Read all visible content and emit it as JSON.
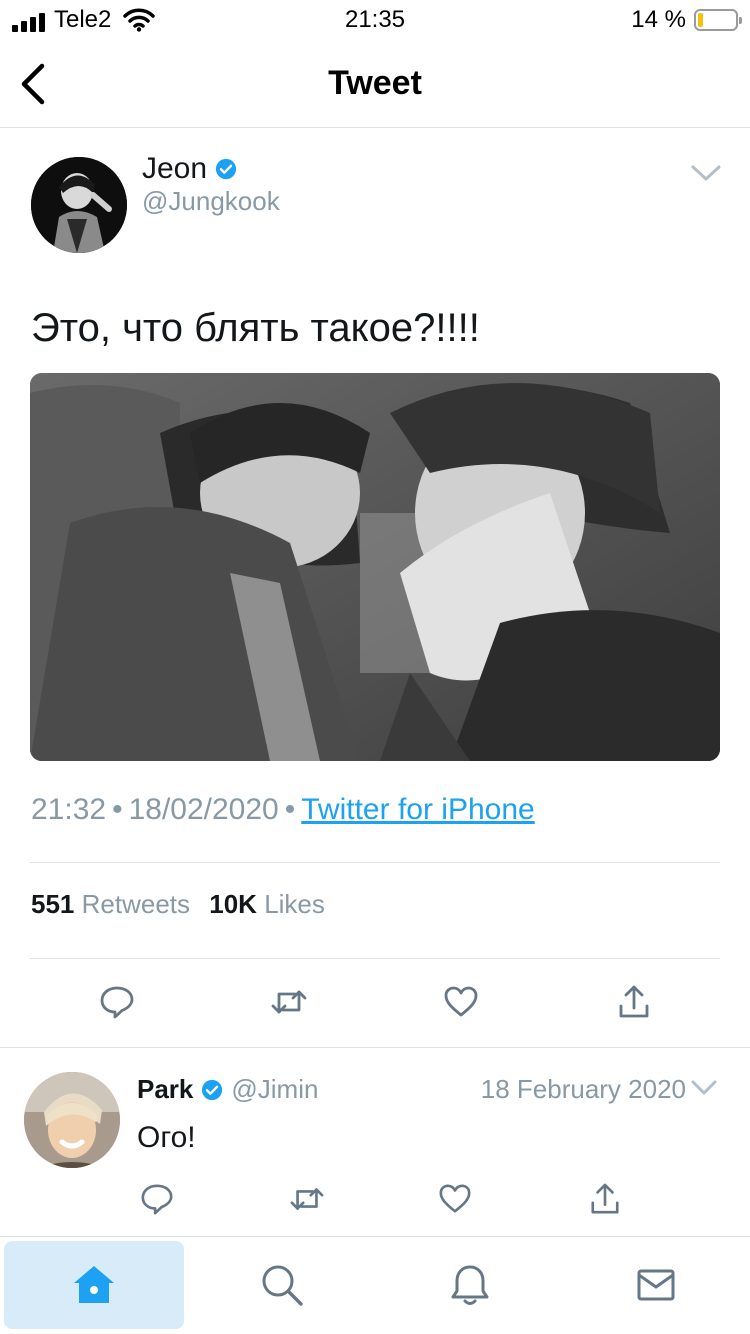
{
  "status_bar": {
    "carrier": "Tele2",
    "time": "21:35",
    "battery": "14 %"
  },
  "nav": {
    "title": "Tweet"
  },
  "tweet": {
    "author_name": "Jeon",
    "author_handle": "@Jungkook",
    "text": "Это, что блять такое?!!!!",
    "time": "21:32",
    "date": "18/02/2020",
    "separator": "•",
    "source": "Twitter for iPhone",
    "retweets_count": "551",
    "retweets_label": "Retweets",
    "likes_count": "10K",
    "likes_label": "Likes"
  },
  "reply": {
    "author_name": "Park",
    "author_handle": "@Jimin",
    "date": "18 February 2020",
    "text": "Ого!"
  },
  "tabbar": {
    "active": "home"
  },
  "colors": {
    "accent": "#1da1f2",
    "muted": "#8899a6",
    "text": "#14171a",
    "active_tab_bg": "#d8ebf9"
  }
}
